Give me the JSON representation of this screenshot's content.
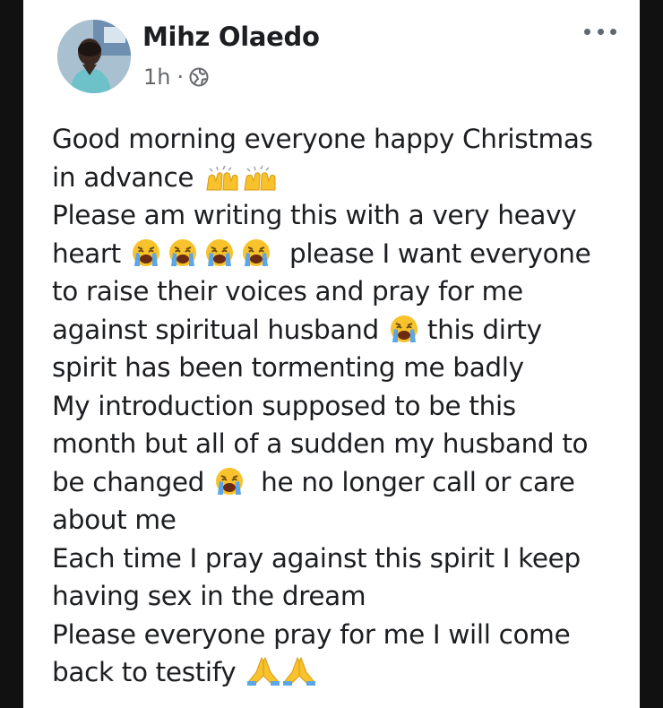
{
  "post": {
    "author": "Mihz Olaedo",
    "time": "1h",
    "separator": "·",
    "audience_icon": "globe-icon",
    "menu_icon": "more-options-icon",
    "lines": [
      "Good morning everyone happy Christmas",
      "in advance",
      "Please am writing this with a very heavy",
      "heart",
      "please I want everyone",
      "to raise their voices and pray for me",
      "against spiritual husband",
      "this dirty",
      "spirit has been tormenting me badly",
      "My introduction supposed to be this",
      "month but all of a sudden my husband to",
      "be changed",
      "he no longer call or care",
      "about me",
      "Each time I pray against this spirit I keep",
      "having sex in the dream",
      "Please everyone pray for me I will come",
      "back to testify"
    ],
    "emojis": {
      "raised_hands": "raised-hands-emoji",
      "crying": "loudly-crying-face-emoji",
      "praying": "folded-hands-emoji"
    }
  },
  "colors": {
    "background": "#111111",
    "card": "#ffffff",
    "text": "#1c1e21",
    "secondary": "#65676b",
    "emoji_yellow": "#f7c22b",
    "tears_blue": "#5aa6e8"
  }
}
